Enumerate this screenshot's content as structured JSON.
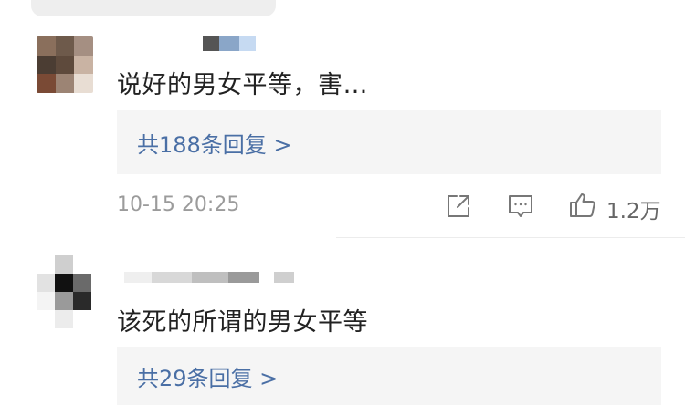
{
  "comments": [
    {
      "text": "说好的男女平等，害…",
      "reply_link": "共188条回复 >",
      "time": "10-15 20:25",
      "likes": "1.2万",
      "icons": [
        "share-icon",
        "comment-icon",
        "like-icon"
      ]
    },
    {
      "text": "该死的所谓的男女平等",
      "reply_link": "共29条回复 >"
    }
  ],
  "colors": {
    "link": "#4a6fa5",
    "reply_bg": "#f5f5f5",
    "meta": "#9b9b9b"
  }
}
